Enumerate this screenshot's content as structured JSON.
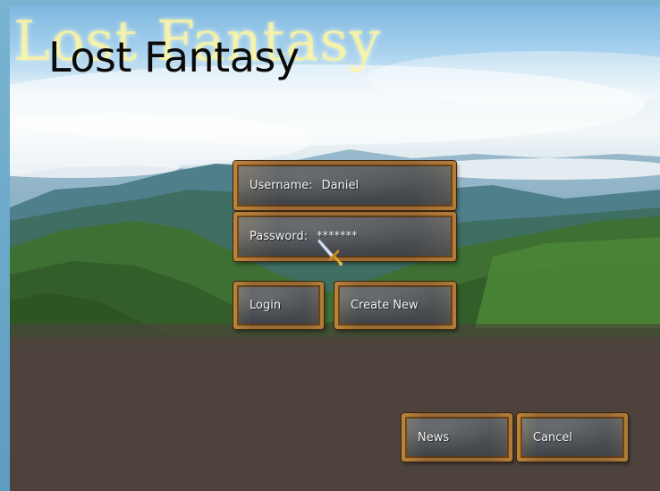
{
  "game": {
    "title": "Lost Fantasy",
    "title_glow": "Lost Fantasy"
  },
  "login_form": {
    "username_label": "Username:",
    "username_value": "Daniel",
    "password_label": "Password:",
    "password_value": "*******"
  },
  "buttons": {
    "login": "Login",
    "create_new": "Create New",
    "news": "News",
    "cancel": "Cancel"
  },
  "cursor": {
    "icon": "sword-cursor-icon"
  },
  "colors": {
    "wood_frame": "#9a6a35",
    "panel_fill": "#4a4e52",
    "title_text": "#0a0a0a",
    "title_glow": "#fff596"
  }
}
